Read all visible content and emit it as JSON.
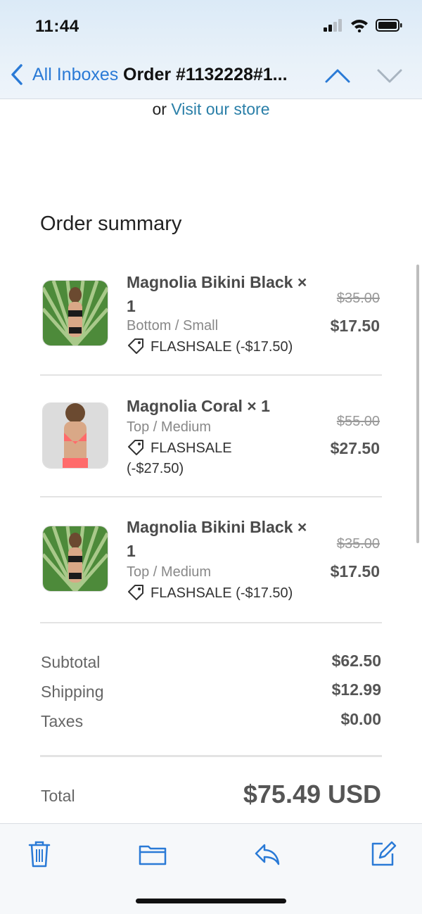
{
  "status": {
    "time": "11:44"
  },
  "nav": {
    "back_label": "All Inboxes",
    "title": "Order #1132228#1..."
  },
  "store": {
    "prefix": "or",
    "link": "Visit our store"
  },
  "summary": {
    "title": "Order summary",
    "items": [
      {
        "name": "Magnolia Bikini Black × 1",
        "variant": "Bottom / Small",
        "discount": "FLASHSALE (-$17.50)",
        "original_price": "$35.00",
        "price": "$17.50",
        "image": "magnolia-bikini-black-photo"
      },
      {
        "name": "Magnolia Coral × 1",
        "variant": "Top / Medium",
        "discount": "FLASHSALE (-$27.50)",
        "original_price": "$55.00",
        "price": "$27.50",
        "image": "magnolia-coral-photo"
      },
      {
        "name": "Magnolia Bikini Black × 1",
        "variant": "Top / Medium",
        "discount": "FLASHSALE (-$17.50)",
        "original_price": "$35.00",
        "price": "$17.50",
        "image": "magnolia-bikini-black-photo"
      }
    ]
  },
  "totals": {
    "subtotal_label": "Subtotal",
    "subtotal": "$62.50",
    "shipping_label": "Shipping",
    "shipping": "$12.99",
    "taxes_label": "Taxes",
    "taxes": "$0.00",
    "total_label": "Total",
    "total": "$75.49 USD"
  },
  "toolbar": {
    "icons": [
      "trash-icon",
      "folder-icon",
      "reply-icon",
      "compose-icon"
    ]
  },
  "colors": {
    "accent": "#2a7ad6",
    "link": "#2a7fa8",
    "header_bg": "#e3eef8"
  }
}
